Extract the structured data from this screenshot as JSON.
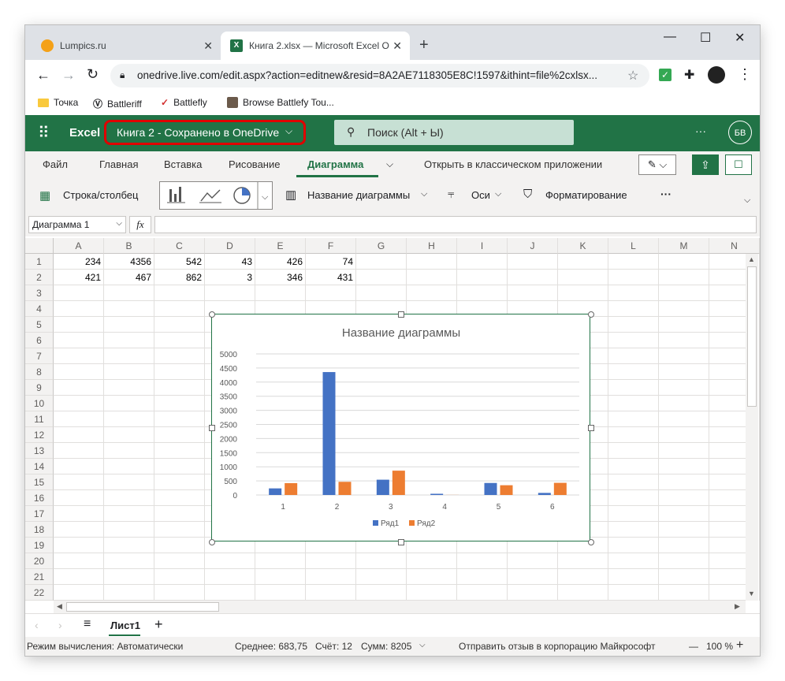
{
  "browser": {
    "tabs": [
      {
        "title": "Lumpics.ru",
        "close": "✕"
      },
      {
        "title": "Книга 2.xlsx — Microsoft Excel О",
        "close": "✕"
      }
    ],
    "new_tab": "+",
    "window_controls": {
      "minimize": "—",
      "maximize": "☐",
      "close": "✕"
    },
    "url": "onedrive.live.com/edit.aspx?action=editnew&resid=8A2AE7118305E8C!1597&ithint=file%2cxlsx...",
    "bookmarks": [
      "Точка",
      "Battleriff",
      "Battlefly",
      "Browse Battlefy Tou..."
    ]
  },
  "excel": {
    "app_name": "Excel",
    "doc_title": "Книга 2  -  Сохранено в OneDrive",
    "search_placeholder": "Поиск (Alt + Ы)",
    "more": "···",
    "avatar": "БВ",
    "ribbon_tabs": [
      "Файл",
      "Главная",
      "Вставка",
      "Рисование",
      "Диаграмма"
    ],
    "open_desktop": "Открыть в классическом приложении",
    "ribbon": {
      "row_col": "Строка/столбец",
      "chart_title": "Название диаграммы",
      "axes": "Оси",
      "formatting": "Форматирование",
      "more": "···"
    },
    "name_box": "Диаграмма 1",
    "fx": "fx",
    "columns": [
      "A",
      "B",
      "C",
      "D",
      "E",
      "F",
      "G",
      "H",
      "I",
      "J",
      "K",
      "L",
      "M",
      "N"
    ],
    "rows": [
      "1",
      "2",
      "3",
      "4",
      "5",
      "6",
      "7",
      "8",
      "9",
      "10",
      "11",
      "12",
      "13",
      "14",
      "15",
      "16",
      "17",
      "18",
      "19",
      "20",
      "21",
      "22"
    ],
    "cells": [
      [
        "234",
        "4356",
        "542",
        "43",
        "426",
        "74"
      ],
      [
        "421",
        "467",
        "862",
        "3",
        "346",
        "431"
      ]
    ],
    "sheet_tab": "Лист1",
    "add_sheet": "+",
    "status": {
      "calc_mode": "Режим вычисления: Автоматически",
      "average": "Среднее: 683,75",
      "count": "Счёт: 12",
      "sum": "Сумм: 8205",
      "feedback": "Отправить отзыв в корпорацию Майкрософт",
      "zoom_minus": "—",
      "zoom": "100 %",
      "zoom_plus": "+"
    }
  },
  "colors": {
    "excel_green": "#217346",
    "series1": "#4472c4",
    "series2": "#ed7d31",
    "highlight": "#e00000"
  },
  "chart_data": {
    "type": "bar",
    "title": "Название диаграммы",
    "categories": [
      "1",
      "2",
      "3",
      "4",
      "5",
      "6"
    ],
    "series": [
      {
        "name": "Ряд1",
        "values": [
          234,
          4356,
          542,
          43,
          426,
          74
        ]
      },
      {
        "name": "Ряд2",
        "values": [
          421,
          467,
          862,
          3,
          346,
          431
        ]
      }
    ],
    "yticks": [
      "0",
      "500",
      "1000",
      "1500",
      "2000",
      "2500",
      "3000",
      "3500",
      "4000",
      "4500",
      "5000"
    ],
    "ylim": [
      0,
      5000
    ],
    "legend": "bottom",
    "grid": true
  }
}
